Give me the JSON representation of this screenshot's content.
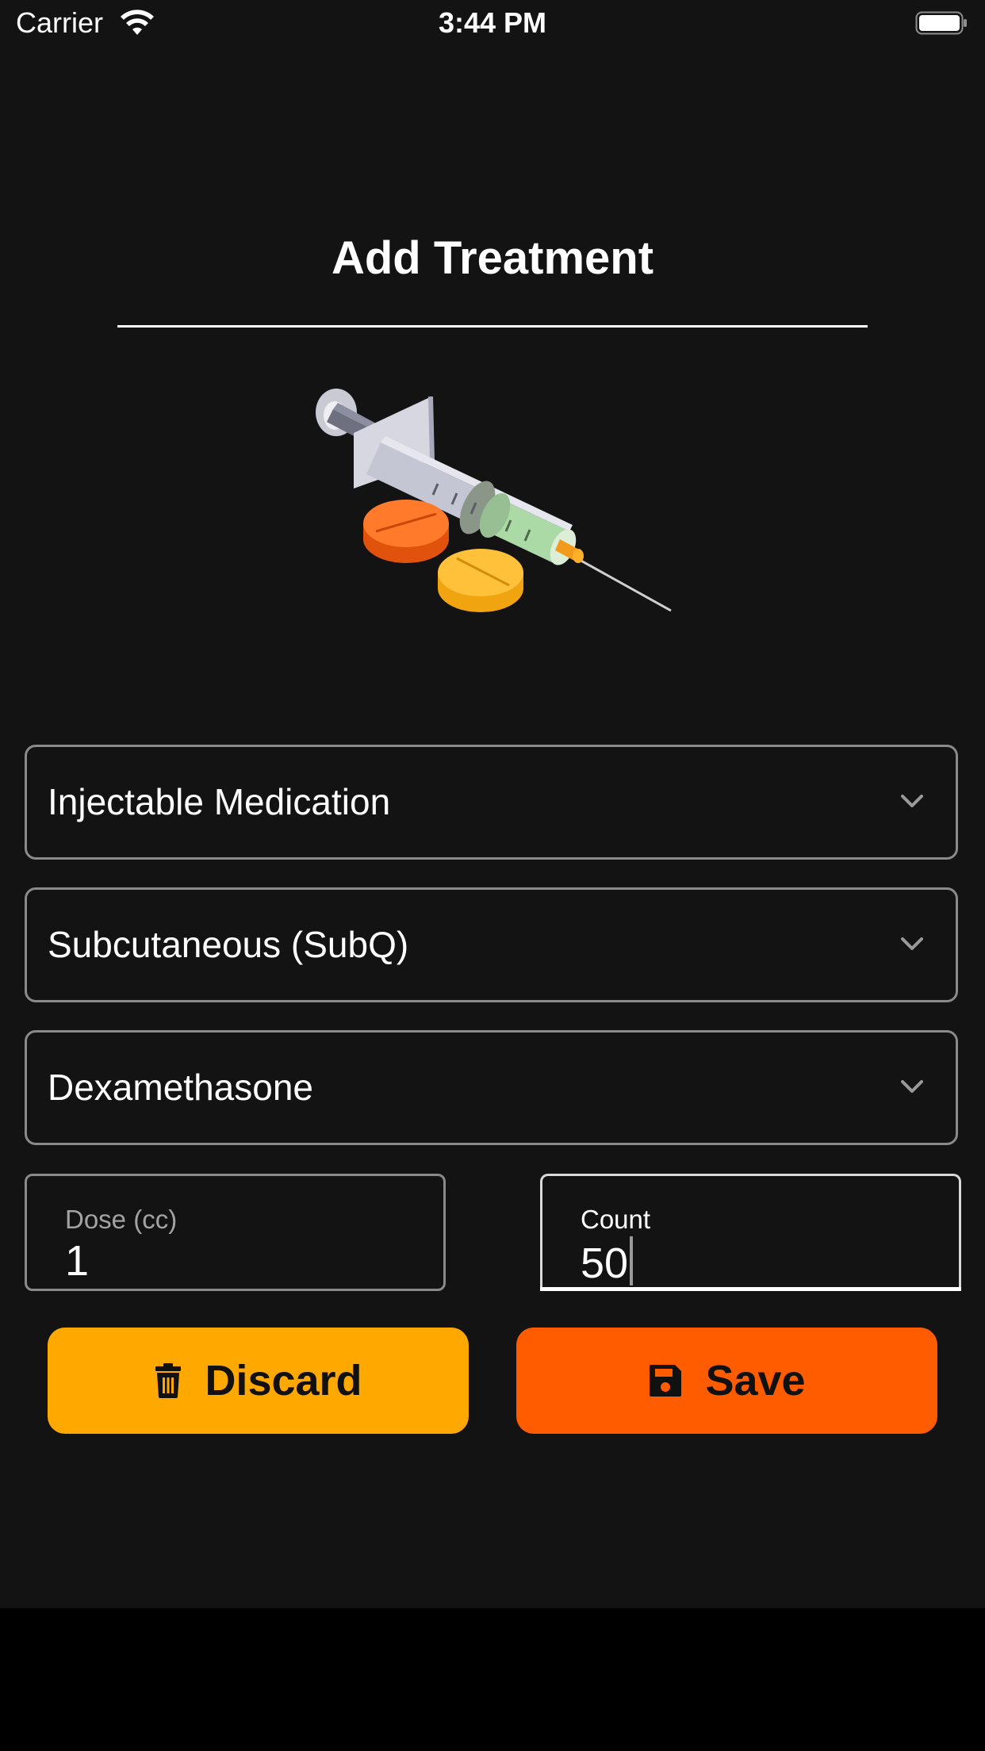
{
  "status_bar": {
    "carrier": "Carrier",
    "time": "3:44 PM"
  },
  "header": {
    "title": "Add Treatment"
  },
  "illustration": {
    "icon": "syringe-and-pills-illustration"
  },
  "form": {
    "treatment_type": {
      "value": "Injectable Medication"
    },
    "route": {
      "value": "Subcutaneous (SubQ)"
    },
    "medication": {
      "value": "Dexamethasone"
    },
    "dose": {
      "label": "Dose (cc)",
      "value": "1"
    },
    "count": {
      "label": "Count",
      "value": "50"
    }
  },
  "actions": {
    "discard_label": "Discard",
    "save_label": "Save"
  },
  "colors": {
    "background": "#131313",
    "discard": "#ffa800",
    "save": "#ff5c00",
    "border": "#8a8a8a"
  }
}
